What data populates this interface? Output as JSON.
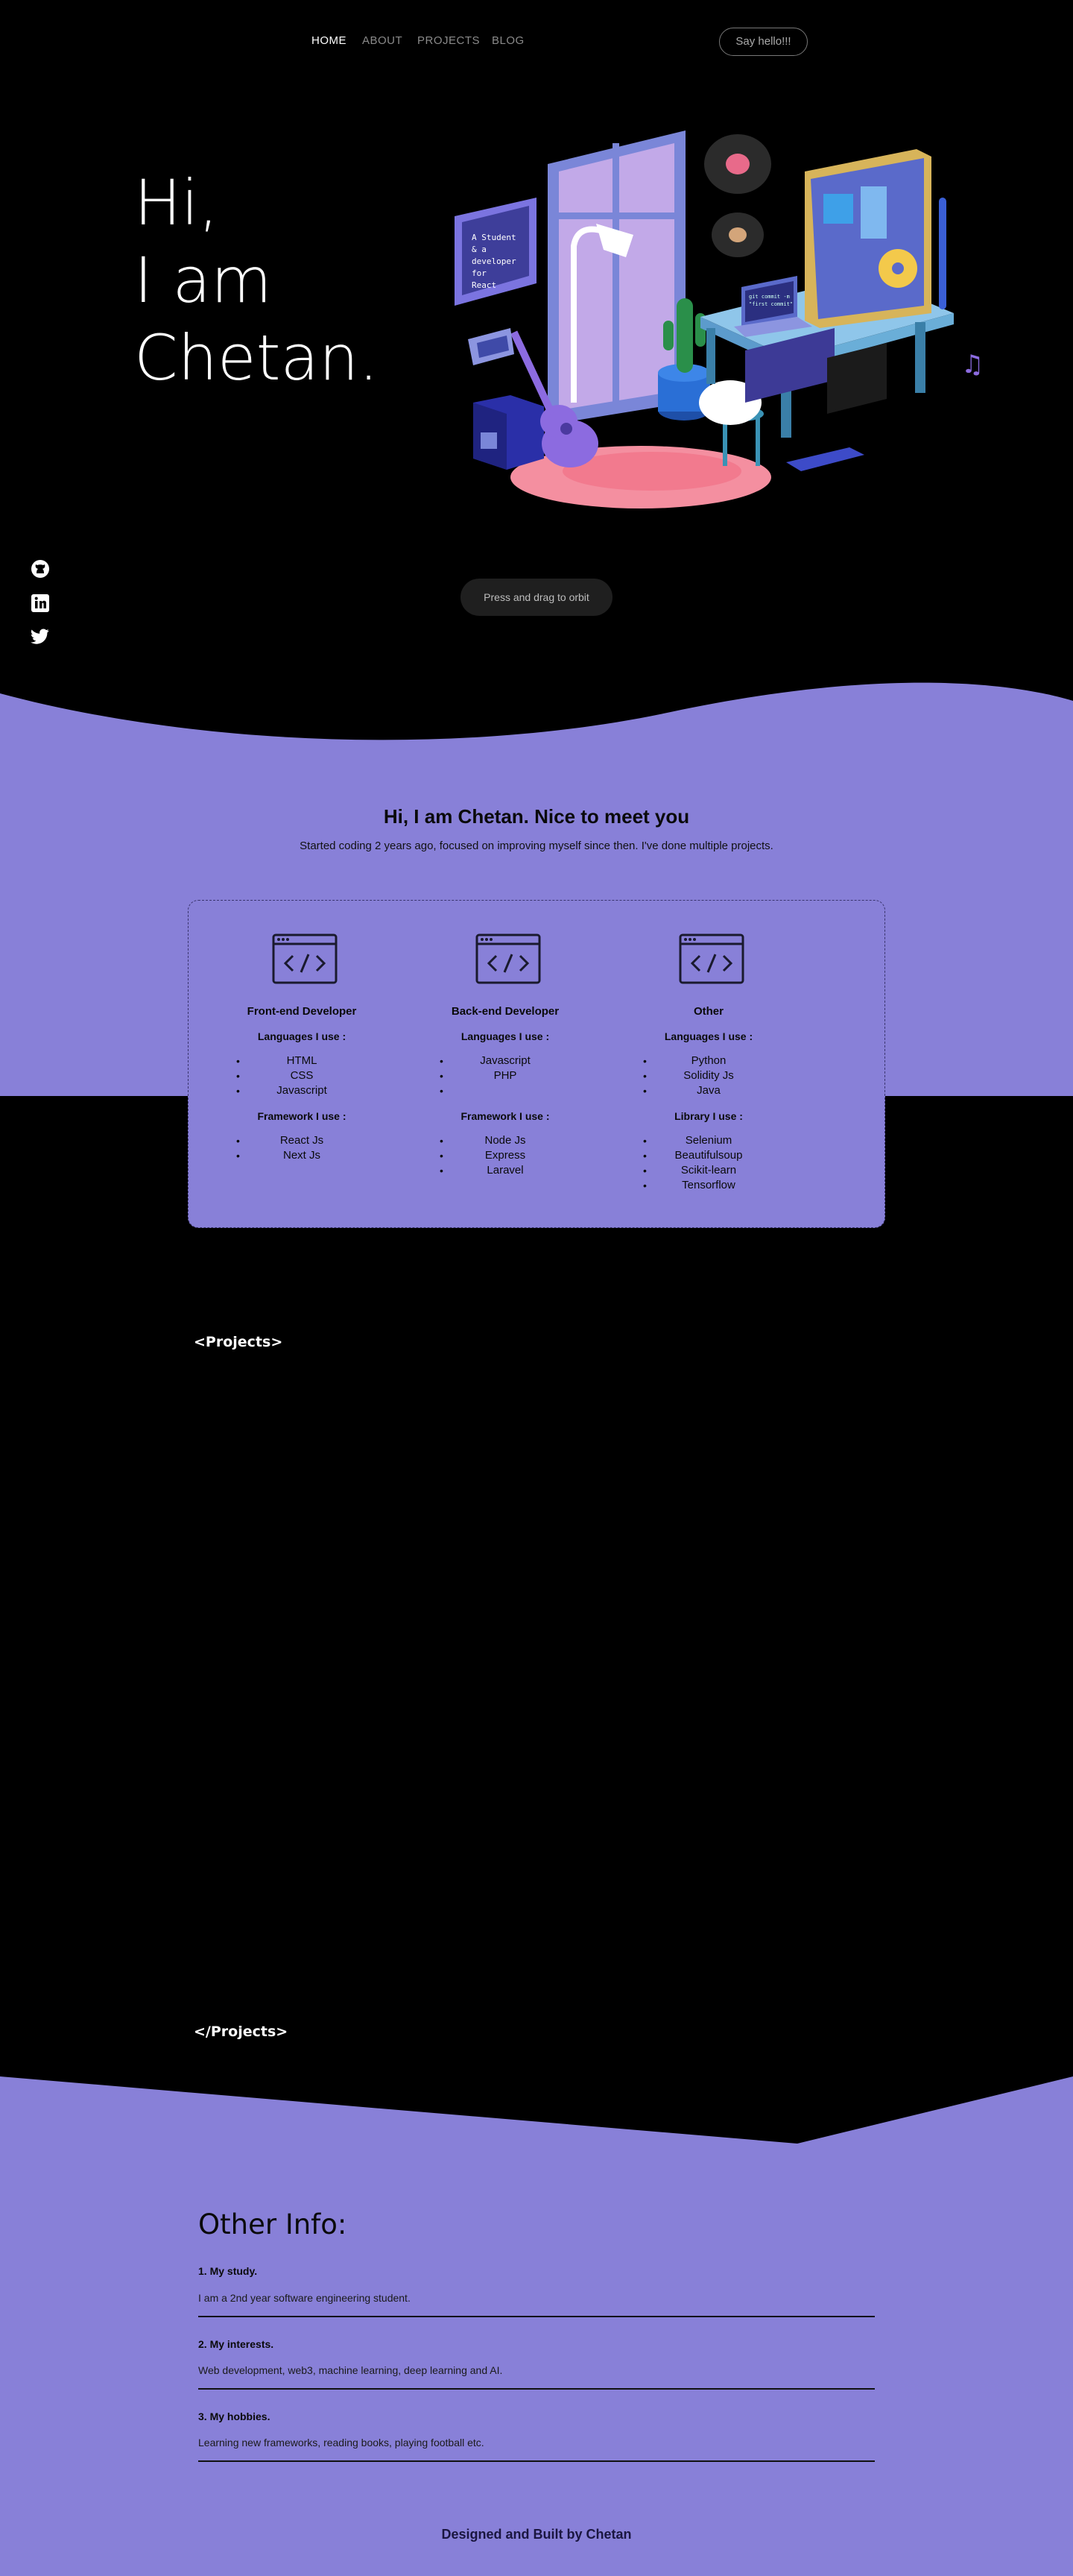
{
  "nav": {
    "links": [
      "HOME",
      "ABOUT",
      "PROJECTS",
      "BLOG"
    ],
    "cta": "Say hello!!!"
  },
  "hero": {
    "lines": [
      "Hi,",
      "I am",
      "Chetan."
    ],
    "orbit_hint": "Press and drag to orbit"
  },
  "social": {
    "icons": [
      "github-icon",
      "linkedin-icon",
      "twitter-icon"
    ]
  },
  "about": {
    "title": "Hi, I am Chetan. Nice to meet you",
    "subtitle": "Started coding 2 years ago, focused on improving myself since then. I've done multiple projects.",
    "columns": [
      {
        "title": "Front-end Developer",
        "lang_heading": "Languages I use :",
        "languages": [
          "HTML",
          "CSS",
          "Javascript"
        ],
        "fw_heading": "Framework I use :",
        "frameworks": [
          "React Js",
          "Next Js"
        ]
      },
      {
        "title": "Back-end Developer",
        "lang_heading": "Languages I use :",
        "languages": [
          "Javascript",
          "PHP"
        ],
        "fw_heading": "Framework I use :",
        "frameworks": [
          "Node Js",
          "Express",
          "Laravel"
        ]
      },
      {
        "title": "Other",
        "lang_heading": "Languages I use :",
        "languages": [
          "Python",
          "Solidity Js",
          "Java"
        ],
        "fw_heading": "Library I use :",
        "frameworks": [
          "Selenium",
          "Beautifulsoup",
          "Scikit-learn",
          "Tensorflow"
        ]
      }
    ]
  },
  "projects": {
    "open_tag": "<Projects>",
    "close_tag": "</Projects>"
  },
  "other": {
    "title": "Other Info:",
    "items": [
      {
        "heading": "1. My study.",
        "text": "I am a 2nd year software engineering student."
      },
      {
        "heading": "2. My interests.",
        "text": "Web development, web3, machine learning, deep learning and AI."
      },
      {
        "heading": "3. My hobbies.",
        "text": "Learning new frameworks, reading books, playing football etc."
      }
    ]
  },
  "footer": "Designed and Built by Chetan",
  "colors": {
    "background": "#000000",
    "accent": "#8880d8",
    "pink_rug": "#f48fa0"
  }
}
